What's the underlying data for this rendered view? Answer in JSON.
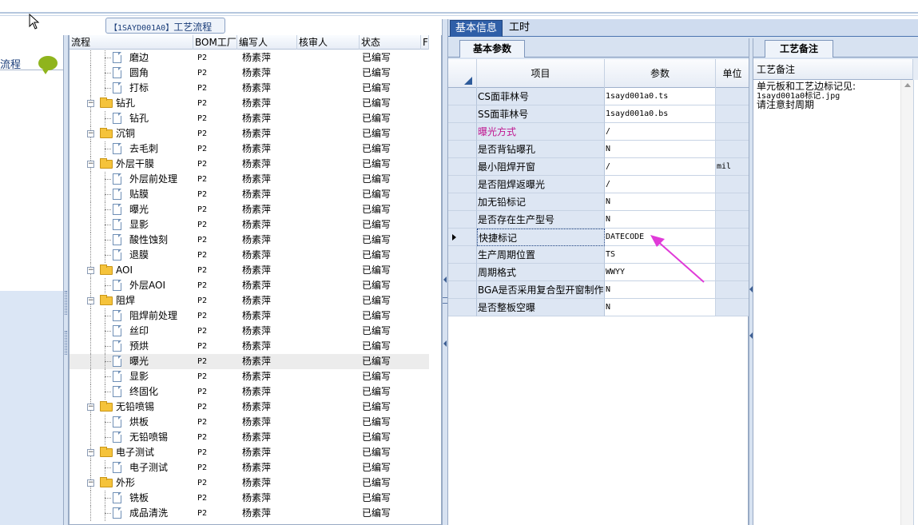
{
  "tree_panel": {
    "caption_code": "【1SAYD001A0】",
    "caption_text": "工艺流程",
    "columns": [
      "流程",
      "BOM工厂",
      "编写人",
      "核审人",
      "状态",
      "F"
    ]
  },
  "left_pane": {
    "title": "流程"
  },
  "tree_rows": [
    {
      "name": "磨边",
      "level": 2,
      "type": "doc",
      "bom": "P2",
      "author": "杨素萍",
      "status": "已编写"
    },
    {
      "name": "圆角",
      "level": 2,
      "type": "doc",
      "bom": "P2",
      "author": "杨素萍",
      "status": "已编写"
    },
    {
      "name": "打标",
      "level": 2,
      "type": "doc",
      "bom": "P2",
      "author": "杨素萍",
      "status": "已编写"
    },
    {
      "name": "钻孔",
      "level": 1,
      "type": "folder",
      "bom": "P2",
      "author": "杨素萍",
      "status": "已编写"
    },
    {
      "name": "钻孔",
      "level": 2,
      "type": "doc",
      "bom": "P2",
      "author": "杨素萍",
      "status": "已编写"
    },
    {
      "name": "沉铜",
      "level": 1,
      "type": "folder",
      "bom": "P2",
      "author": "杨素萍",
      "status": "已编写"
    },
    {
      "name": "去毛刺",
      "level": 2,
      "type": "doc",
      "bom": "P2",
      "author": "杨素萍",
      "status": "已编写"
    },
    {
      "name": "外层干膜",
      "level": 1,
      "type": "folder",
      "bom": "P2",
      "author": "杨素萍",
      "status": "已编写"
    },
    {
      "name": "外层前处理",
      "level": 2,
      "type": "doc",
      "bom": "P2",
      "author": "杨素萍",
      "status": "已编写"
    },
    {
      "name": "贴膜",
      "level": 2,
      "type": "doc",
      "bom": "P2",
      "author": "杨素萍",
      "status": "已编写"
    },
    {
      "name": "曝光",
      "level": 2,
      "type": "doc",
      "bom": "P2",
      "author": "杨素萍",
      "status": "已编写"
    },
    {
      "name": "显影",
      "level": 2,
      "type": "doc",
      "bom": "P2",
      "author": "杨素萍",
      "status": "已编写"
    },
    {
      "name": "酸性蚀刻",
      "level": 2,
      "type": "doc",
      "bom": "P2",
      "author": "杨素萍",
      "status": "已编写"
    },
    {
      "name": "退膜",
      "level": 2,
      "type": "doc",
      "bom": "P2",
      "author": "杨素萍",
      "status": "已编写"
    },
    {
      "name": "AOI",
      "level": 1,
      "type": "folder",
      "bom": "P2",
      "author": "杨素萍",
      "status": "已编写"
    },
    {
      "name": "外层AOI",
      "level": 2,
      "type": "doc",
      "bom": "P2",
      "author": "杨素萍",
      "status": "已编写"
    },
    {
      "name": "阻焊",
      "level": 1,
      "type": "folder",
      "bom": "P2",
      "author": "杨素萍",
      "status": "已编写"
    },
    {
      "name": "阻焊前处理",
      "level": 2,
      "type": "doc",
      "bom": "P2",
      "author": "杨素萍",
      "status": "已编写"
    },
    {
      "name": "丝印",
      "level": 2,
      "type": "doc",
      "bom": "P2",
      "author": "杨素萍",
      "status": "已编写"
    },
    {
      "name": "预烘",
      "level": 2,
      "type": "doc",
      "bom": "P2",
      "author": "杨素萍",
      "status": "已编写"
    },
    {
      "name": "曝光",
      "level": 2,
      "type": "doc",
      "bom": "P2",
      "author": "杨素萍",
      "status": "已编写",
      "selected": true
    },
    {
      "name": "显影",
      "level": 2,
      "type": "doc",
      "bom": "P2",
      "author": "杨素萍",
      "status": "已编写"
    },
    {
      "name": "终固化",
      "level": 2,
      "type": "doc",
      "bom": "P2",
      "author": "杨素萍",
      "status": "已编写"
    },
    {
      "name": "无铅喷锡",
      "level": 1,
      "type": "folder",
      "bom": "P2",
      "author": "杨素萍",
      "status": "已编写"
    },
    {
      "name": "烘板",
      "level": 2,
      "type": "doc",
      "bom": "P2",
      "author": "杨素萍",
      "status": "已编写"
    },
    {
      "name": "无铅喷锡",
      "level": 2,
      "type": "doc",
      "bom": "P2",
      "author": "杨素萍",
      "status": "已编写"
    },
    {
      "name": "电子测试",
      "level": 1,
      "type": "folder",
      "bom": "P2",
      "author": "杨素萍",
      "status": "已编写"
    },
    {
      "name": "电子测试",
      "level": 2,
      "type": "doc",
      "bom": "P2",
      "author": "杨素萍",
      "status": "已编写"
    },
    {
      "name": "外形",
      "level": 1,
      "type": "folder",
      "bom": "P2",
      "author": "杨素萍",
      "status": "已编写"
    },
    {
      "name": "铣板",
      "level": 2,
      "type": "doc",
      "bom": "P2",
      "author": "杨素萍",
      "status": "已编写"
    },
    {
      "name": "成品清洗",
      "level": 2,
      "type": "doc",
      "bom": "P2",
      "author": "杨素萍",
      "status": "已编写"
    }
  ],
  "tabs": {
    "basic": "基本信息",
    "hours": "工时"
  },
  "subtabs": {
    "params": "基本参数",
    "notes": "工艺备注"
  },
  "grid": {
    "columns": {
      "item": "项目",
      "param": "参数",
      "unit": "单位"
    },
    "rows": [
      {
        "item": "CS面菲林号",
        "param": "1sayd001a0.ts",
        "unit": ""
      },
      {
        "item": "SS面菲林号",
        "param": "1sayd001a0.bs",
        "unit": ""
      },
      {
        "item": "曝光方式",
        "param": "/",
        "unit": "",
        "pink": true
      },
      {
        "item": "是否背钻曝孔",
        "param": "N",
        "unit": ""
      },
      {
        "item": "最小阻焊开窗",
        "param": "/",
        "unit": "mil"
      },
      {
        "item": "是否阻焊返曝光",
        "param": "/",
        "unit": ""
      },
      {
        "item": "加无铅标记",
        "param": "N",
        "unit": ""
      },
      {
        "item": "是否存在生产型号",
        "param": "N",
        "unit": ""
      },
      {
        "item": "快捷标记",
        "param": "DATECODE",
        "unit": "",
        "current": true
      },
      {
        "item": "生产周期位置",
        "param": "TS",
        "unit": ""
      },
      {
        "item": "周期格式",
        "param": "WWYY",
        "unit": ""
      },
      {
        "item": "BGA是否采用复合型开窗制作",
        "param": "N",
        "unit": ""
      },
      {
        "item": "是否整板空曝",
        "param": "N",
        "unit": ""
      }
    ]
  },
  "notes": {
    "header": "工艺备注",
    "line1": "单元板和工艺边标记见:",
    "line2": "1sayd001a0标记.jpg",
    "line3": "请注意封周期"
  },
  "colors": {
    "accent": "#2f5fa8",
    "annotation": "#e03ad8",
    "pink_text": "#c0158f"
  },
  "icons": [
    "folder-icon",
    "document-icon",
    "expander-minus-icon",
    "chat-bubble-icon",
    "mouse-cursor-icon",
    "row-pointer-icon"
  ]
}
